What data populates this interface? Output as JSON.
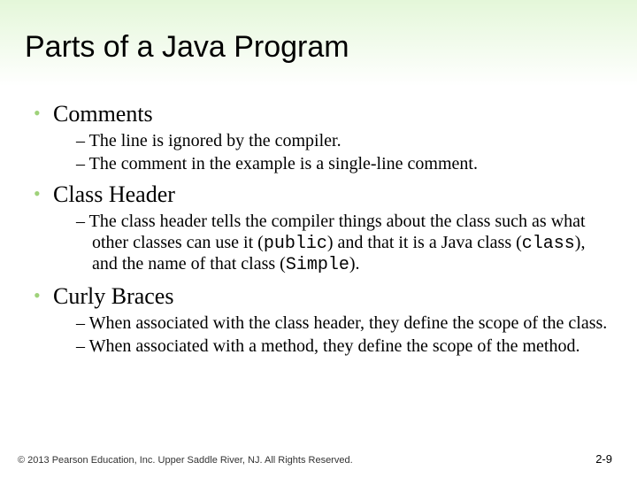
{
  "title": "Parts of a Java Program",
  "sections": [
    {
      "heading": "Comments",
      "items": [
        "The line is ignored by the compiler.",
        "The comment in the example is a single-line comment."
      ]
    },
    {
      "heading": "Class Header",
      "items_rich": [
        [
          {
            "t": "The class header tells the compiler things about the class such as what other classes can use it ("
          },
          {
            "t": "public",
            "code": true
          },
          {
            "t": ") and that it is a Java class ("
          },
          {
            "t": "class",
            "code": true
          },
          {
            "t": "), and the name of that class ("
          },
          {
            "t": "Simple",
            "code": true
          },
          {
            "t": ")."
          }
        ]
      ]
    },
    {
      "heading": "Curly Braces",
      "items": [
        "When associated with the class header, they define the scope of the class.",
        "When associated with a method, they define the scope of the method."
      ]
    }
  ],
  "footer": "© 2013 Pearson Education, Inc. Upper Saddle River, NJ. All Rights Reserved.",
  "page_number": "2-9"
}
